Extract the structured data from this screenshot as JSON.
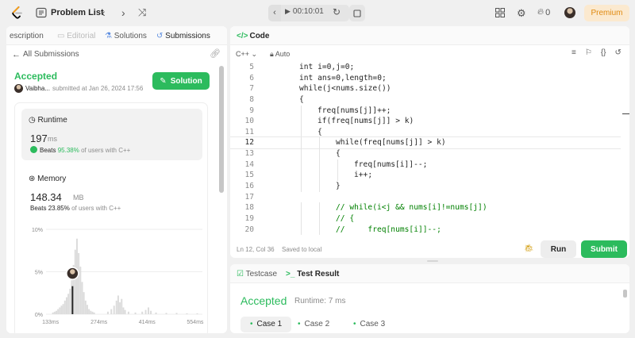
{
  "topbar": {
    "problem_list": "Problem List",
    "timer": "00:10:01",
    "streak": "0",
    "premium": "Premium"
  },
  "left": {
    "tabs": [
      "escription",
      "Editorial",
      "Solutions",
      "Submissions"
    ],
    "all_submissions": "All Submissions",
    "status": "Accepted",
    "user": "Vaibha...",
    "submitted": "submitted at Jan 26, 2024 17:56",
    "solution_button": "Solution",
    "runtime": {
      "label": "Runtime",
      "value": "197",
      "unit": "ms",
      "beats_prefix": "Beats",
      "beats_pct": "95.38%",
      "beats_suffix": "of users with C++"
    },
    "memory": {
      "label": "Memory",
      "value": "148.34",
      "unit": "MB",
      "beats_prefix": "Beats",
      "beats_pct": "23.85%",
      "beats_suffix": "of users with C++"
    }
  },
  "chart_data": {
    "type": "bar",
    "y_ticks": [
      "10%",
      "5%",
      "0%"
    ],
    "x_ticks": [
      "133ms",
      "274ms",
      "414ms",
      "554ms"
    ],
    "ylim": [
      0,
      10
    ],
    "xlim": [
      120,
      575
    ],
    "highlight": 197,
    "bars": [
      {
        "x": 140,
        "y": 0.2
      },
      {
        "x": 145,
        "y": 0.3
      },
      {
        "x": 150,
        "y": 0.4
      },
      {
        "x": 155,
        "y": 0.6
      },
      {
        "x": 160,
        "y": 0.8
      },
      {
        "x": 165,
        "y": 1.0
      },
      {
        "x": 170,
        "y": 1.2
      },
      {
        "x": 175,
        "y": 1.6
      },
      {
        "x": 180,
        "y": 2.0
      },
      {
        "x": 185,
        "y": 2.4
      },
      {
        "x": 190,
        "y": 3.0
      },
      {
        "x": 195,
        "y": 4.0
      },
      {
        "x": 200,
        "y": 5.8
      },
      {
        "x": 205,
        "y": 7.6
      },
      {
        "x": 210,
        "y": 8.9
      },
      {
        "x": 215,
        "y": 7.2
      },
      {
        "x": 220,
        "y": 5.6
      },
      {
        "x": 225,
        "y": 3.8
      },
      {
        "x": 230,
        "y": 2.6
      },
      {
        "x": 235,
        "y": 1.6
      },
      {
        "x": 240,
        "y": 1.1
      },
      {
        "x": 245,
        "y": 0.6
      },
      {
        "x": 250,
        "y": 0.4
      },
      {
        "x": 255,
        "y": 0.3
      },
      {
        "x": 260,
        "y": 0.2
      },
      {
        "x": 300,
        "y": 0.3
      },
      {
        "x": 310,
        "y": 0.6
      },
      {
        "x": 318,
        "y": 1.0
      },
      {
        "x": 325,
        "y": 1.6
      },
      {
        "x": 330,
        "y": 2.2
      },
      {
        "x": 335,
        "y": 1.4
      },
      {
        "x": 340,
        "y": 1.8
      },
      {
        "x": 345,
        "y": 0.8
      },
      {
        "x": 350,
        "y": 0.5
      },
      {
        "x": 360,
        "y": 0.3
      },
      {
        "x": 380,
        "y": 0.2
      },
      {
        "x": 400,
        "y": 0.3
      },
      {
        "x": 410,
        "y": 0.5
      },
      {
        "x": 418,
        "y": 0.8
      },
      {
        "x": 425,
        "y": 0.4
      },
      {
        "x": 440,
        "y": 0.2
      },
      {
        "x": 470,
        "y": 0.15
      },
      {
        "x": 500,
        "y": 0.15
      },
      {
        "x": 530,
        "y": 0.1
      },
      {
        "x": 560,
        "y": 0.1
      }
    ]
  },
  "code": {
    "title": "Code",
    "language": "C++",
    "mode": "Auto",
    "lines": [
      {
        "n": "5",
        "indent": 0,
        "t": "int i=0,j=0;"
      },
      {
        "n": "6",
        "indent": 0,
        "t": "int ans=0,length=0;"
      },
      {
        "n": "7",
        "indent": 0,
        "t": "while(j<nums.size())"
      },
      {
        "n": "8",
        "indent": 0,
        "t": "{"
      },
      {
        "n": "9",
        "indent": 1,
        "t": "freq[nums[j]]++;"
      },
      {
        "n": "10",
        "indent": 1,
        "t": "if(freq[nums[j]] > k)"
      },
      {
        "n": "11",
        "indent": 1,
        "t": "{"
      },
      {
        "n": "12",
        "indent": 2,
        "t": "while(freq[nums[j]] > k)"
      },
      {
        "n": "13",
        "indent": 2,
        "t": "{"
      },
      {
        "n": "14",
        "indent": 3,
        "t": "freq[nums[i]]--;"
      },
      {
        "n": "15",
        "indent": 3,
        "t": "i++;"
      },
      {
        "n": "16",
        "indent": 2,
        "t": "}"
      },
      {
        "n": "17",
        "indent": 0,
        "t": ""
      },
      {
        "n": "18",
        "indent": 2,
        "t": "// while(i<j && nums[i]!=nums[j])"
      },
      {
        "n": "19",
        "indent": 2,
        "t": "// {"
      },
      {
        "n": "20",
        "indent": 2,
        "t": "//     freq[nums[i]]--;"
      }
    ],
    "cursor": "Ln 12, Col 36",
    "saved": "Saved to local",
    "run": "Run",
    "submit": "Submit"
  },
  "result": {
    "testcase_tab": "Testcase",
    "result_tab": "Test Result",
    "status": "Accepted",
    "runtime": "Runtime: 7 ms",
    "cases": [
      "Case 1",
      "Case 2",
      "Case 3"
    ]
  },
  "colors": {
    "accent_green": "#2cbb5d",
    "premium_text": "#e08a10",
    "premium_bg": "#fbe9cf"
  }
}
